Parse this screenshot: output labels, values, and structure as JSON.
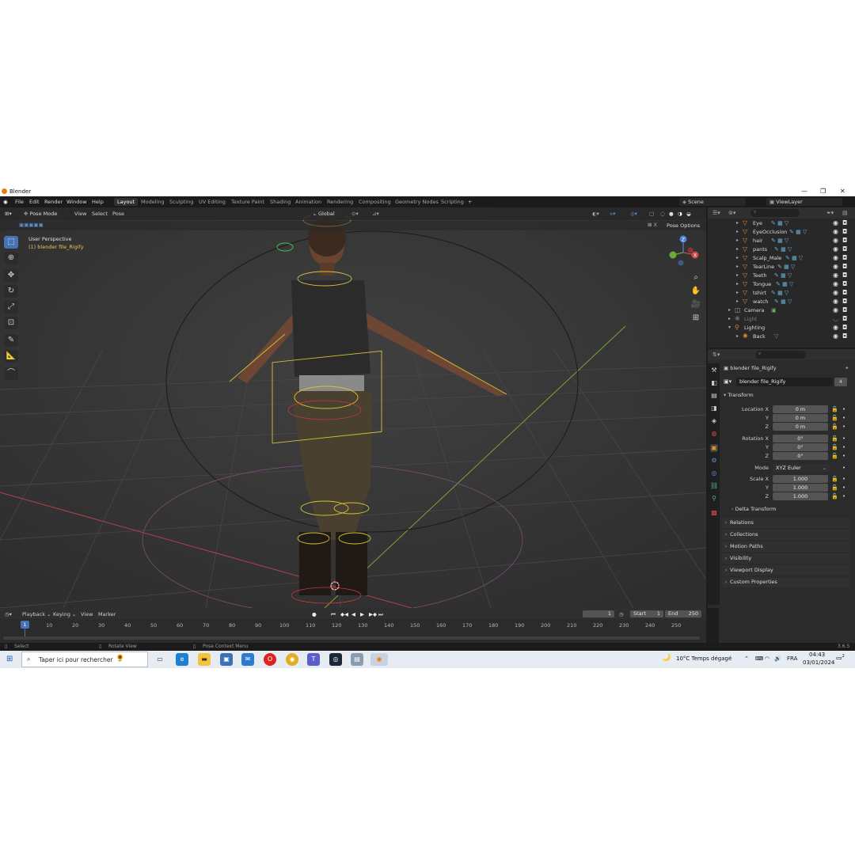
{
  "window": {
    "title": "Blender"
  },
  "menu": [
    "File",
    "Edit",
    "Render",
    "Window",
    "Help"
  ],
  "workspaces": [
    "Layout",
    "Modeling",
    "Sculpting",
    "UV Editing",
    "Texture Paint",
    "Shading",
    "Animation",
    "Rendering",
    "Compositing",
    "Geometry Nodes",
    "Scripting"
  ],
  "active_workspace": "Layout",
  "scene_name": "Scene",
  "view_layer": "ViewLayer",
  "viewport": {
    "mode": "Pose Mode",
    "menus": [
      "View",
      "Select",
      "Pose"
    ],
    "orientation": "Global",
    "pose_options": "Pose Options",
    "perspective_label": "User Perspective",
    "object_label": "(1) blender file_Rigify",
    "gizmo_axis_z": "Z",
    "gizmo_axis_x": "X"
  },
  "outliner": {
    "rows": [
      {
        "label": "Eye"
      },
      {
        "label": "EyeOcclusion"
      },
      {
        "label": "hair"
      },
      {
        "label": "pants"
      },
      {
        "label": "Scalp_Male"
      },
      {
        "label": "TearLine"
      },
      {
        "label": "Teeth"
      },
      {
        "label": "Tongue"
      },
      {
        "label": "tshirt"
      },
      {
        "label": "watch"
      },
      {
        "label": "Camera"
      },
      {
        "label": "Light"
      },
      {
        "label": "Lighting"
      },
      {
        "label": "Back"
      }
    ]
  },
  "properties": {
    "context_object": "blender file_Rigify",
    "data_name": "blender file_Rigify",
    "users_count": "4",
    "transform_title": "Transform",
    "location_label": "Location X",
    "location": [
      "0 m",
      "0 m",
      "0 m"
    ],
    "rotation_label": "Rotation X",
    "rotation": [
      "0°",
      "0°",
      "0°"
    ],
    "mode_label": "Mode",
    "mode_value": "XYZ Euler",
    "scale_label": "Scale X",
    "scale": [
      "1.000",
      "1.000",
      "1.000"
    ],
    "axis_y": "Y",
    "axis_z": "Z",
    "delta_transform": "Delta Transform",
    "sections": [
      "Relations",
      "Collections",
      "Motion Paths",
      "Visibility",
      "Viewport Display",
      "Custom Properties"
    ]
  },
  "timeline": {
    "menus": [
      "Playback",
      "Keying",
      "View",
      "Marker"
    ],
    "current_frame": "1",
    "start_label": "Start",
    "start": "1",
    "end_label": "End",
    "end": "250",
    "ticks": [
      "10",
      "20",
      "30",
      "40",
      "50",
      "60",
      "70",
      "80",
      "90",
      "100",
      "110",
      "120",
      "130",
      "140",
      "150",
      "160",
      "170",
      "180",
      "190",
      "200",
      "210",
      "220",
      "230",
      "240",
      "250"
    ]
  },
  "statusbar": {
    "select": "Select",
    "rotate_view": "Rotate View",
    "context_menu": "Pose Context Menu",
    "version": "3.6.5"
  },
  "taskbar": {
    "search_placeholder": "Taper ici pour rechercher",
    "weather": "10°C  Temps dégagé",
    "lang": "FRA",
    "time": "04:43",
    "date": "03/01/2024",
    "notifications": "2"
  }
}
